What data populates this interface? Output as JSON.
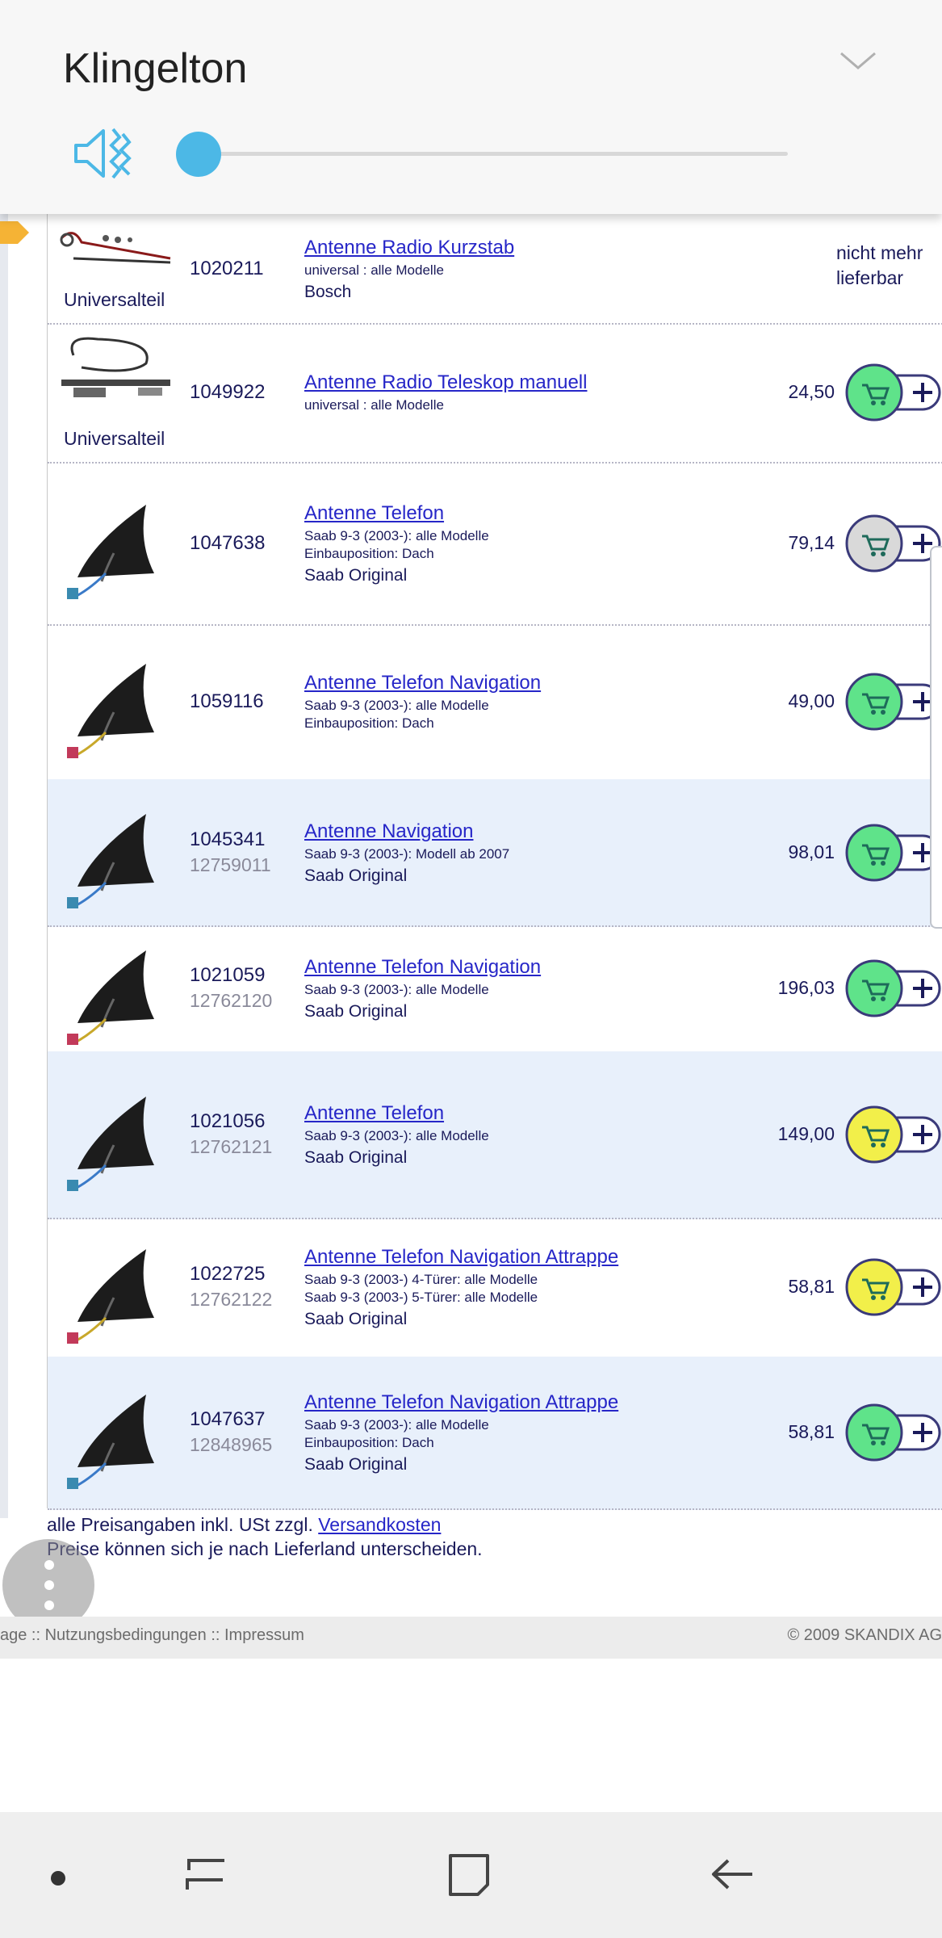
{
  "volume_panel": {
    "title": "Klingelton",
    "level": 0,
    "accent_color": "#4cb8e6",
    "mute_icon": "speaker-vibrate-icon",
    "expand_icon": "chevron-down-icon"
  },
  "products": [
    {
      "thumb_label": "Universalteil",
      "art_nr": "1020211",
      "oe_nr": "",
      "title": "Antenne Radio Kurzstab",
      "lines": [
        "universal : alle Modelle"
      ],
      "brand": "Bosch",
      "price": "",
      "status": "nicht mehr lieferbar",
      "cart_color": ""
    },
    {
      "thumb_label": "Universalteil",
      "art_nr": "1049922",
      "oe_nr": "",
      "title": "Antenne Radio Teleskop manuell",
      "lines": [
        "universal : alle Modelle"
      ],
      "brand": "",
      "price": "24,50",
      "status": "",
      "cart_color": "green"
    },
    {
      "thumb_label": "",
      "art_nr": "1047638",
      "oe_nr": "",
      "title": "Antenne Telefon",
      "lines": [
        "Saab 9-3 (2003-): alle Modelle",
        "Einbauposition: Dach"
      ],
      "brand": "Saab Original",
      "price": "79,14",
      "status": "",
      "cart_color": "grey"
    },
    {
      "thumb_label": "",
      "art_nr": "1059116",
      "oe_nr": "",
      "title": "Antenne Telefon Navigation",
      "lines": [
        "Saab 9-3 (2003-): alle Modelle",
        "Einbauposition: Dach"
      ],
      "brand": "",
      "price": "49,00",
      "status": "",
      "cart_color": "green"
    },
    {
      "thumb_label": "",
      "art_nr": "1045341",
      "oe_nr": "12759011",
      "title": "Antenne Navigation",
      "lines": [
        "Saab 9-3 (2003-): Modell ab 2007"
      ],
      "brand": "Saab Original",
      "price": "98,01",
      "status": "",
      "cart_color": "green"
    },
    {
      "thumb_label": "",
      "art_nr": "1021059",
      "oe_nr": "12762120",
      "title": "Antenne Telefon Navigation",
      "lines": [
        "Saab 9-3 (2003-): alle Modelle"
      ],
      "brand": "Saab Original",
      "price": "196,03",
      "status": "",
      "cart_color": "green"
    },
    {
      "thumb_label": "",
      "art_nr": "1021056",
      "oe_nr": "12762121",
      "title": "Antenne Telefon",
      "lines": [
        "Saab 9-3 (2003-): alle Modelle"
      ],
      "brand": "Saab Original",
      "price": "149,00",
      "status": "",
      "cart_color": "yellow"
    },
    {
      "thumb_label": "",
      "art_nr": "1022725",
      "oe_nr": "12762122",
      "title": "Antenne Telefon Navigation Attrappe",
      "lines": [
        "Saab 9-3 (2003-) 4-Türer: alle Modelle",
        "Saab 9-3 (2003-) 5-Türer: alle Modelle"
      ],
      "brand": "Saab Original",
      "price": "58,81",
      "status": "",
      "cart_color": "yellow"
    },
    {
      "thumb_label": "",
      "art_nr": "1047637",
      "oe_nr": "12848965",
      "title": "Antenne Telefon Navigation Attrappe",
      "lines": [
        "Saab 9-3 (2003-): alle Modelle",
        "Einbauposition: Dach"
      ],
      "brand": "Saab Original",
      "price": "58,81",
      "status": "",
      "cart_color": "green"
    }
  ],
  "colors": {
    "green": "#5fe38a",
    "yellow": "#f2ef4a",
    "grey": "#d9d9d9",
    "row_highlight": "#e8f0fb",
    "link": "#2626c8"
  },
  "footer": {
    "price_note": "alle Preisangaben inkl. USt zzgl.",
    "shipping_link": "Versandkosten",
    "country_note": "Preise können sich je nach Lieferland unterscheiden.",
    "legal_links": "age :: Nutzungsbedingungen :: Impressum",
    "copyright": "© 2009 SKANDIX AG"
  },
  "fab_icon": "more-vertical-icon",
  "navbar": {
    "icons": [
      "dot-icon",
      "recents-icon",
      "home-icon",
      "back-icon"
    ]
  }
}
